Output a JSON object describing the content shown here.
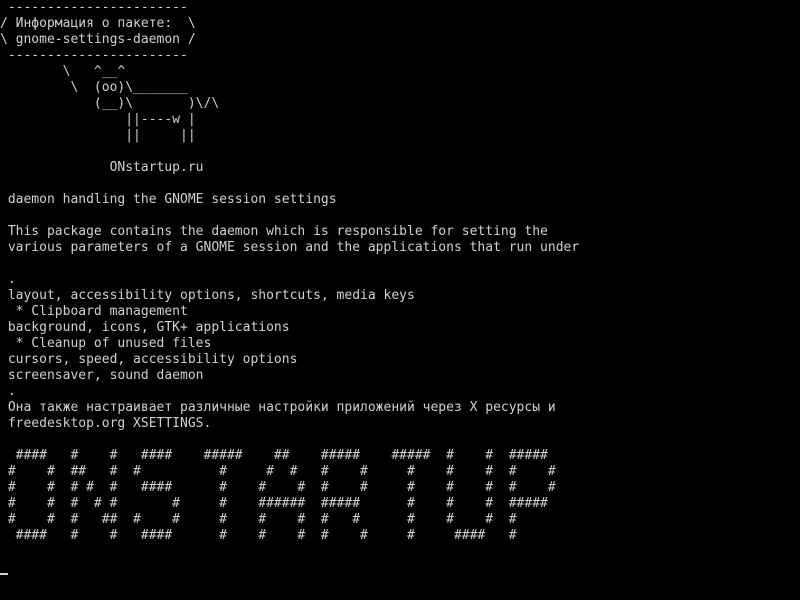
{
  "terminal": {
    "colors": {
      "background": "#000000",
      "foreground": "#d0d0d0"
    },
    "lines": [
      " ----------------------- ",
      "/ Информация о пакете:  \\",
      "\\ gnome-settings-daemon /",
      " ----------------------- ",
      "        \\   ^__^",
      "         \\  (oo)\\_______",
      "            (__)\\       )\\/\\",
      "                ||----w |",
      "                ||     ||",
      "",
      "              ONstartup.ru",
      "",
      " daemon handling the GNOME session settings",
      "",
      " This package contains the daemon which is responsible for setting the",
      " various parameters of a GNOME session and the applications that run under",
      "",
      " .",
      " layout, accessibility options, shortcuts, media keys",
      "  * Clipboard management",
      " background, icons, GTK+ applications",
      "  * Cleanup of unused files",
      " cursors, speed, accessibility options",
      " screensaver, sound daemon",
      " .",
      " Она также настраивает различные настройки приложений через X ресурсы и",
      " freedesktop.org XSETTINGS.",
      "",
      "  ####   #    #   ####    #####    ##    #####    #####  #    #  #####",
      " #    #  ##   #  #          #     #  #   #    #     #    #    #  #    #",
      " #    #  # #  #   ####      #    #    #  #    #     #    #    #  #    #",
      " #    #  #  # #       #     #    ######  #####      #    #    #  #####",
      " #    #  #   ##  #    #     #    #    #  #   #      #    #    #  #",
      "  ####   #    #   ####      #    #    #  #    #     #     ####   #"
    ]
  }
}
